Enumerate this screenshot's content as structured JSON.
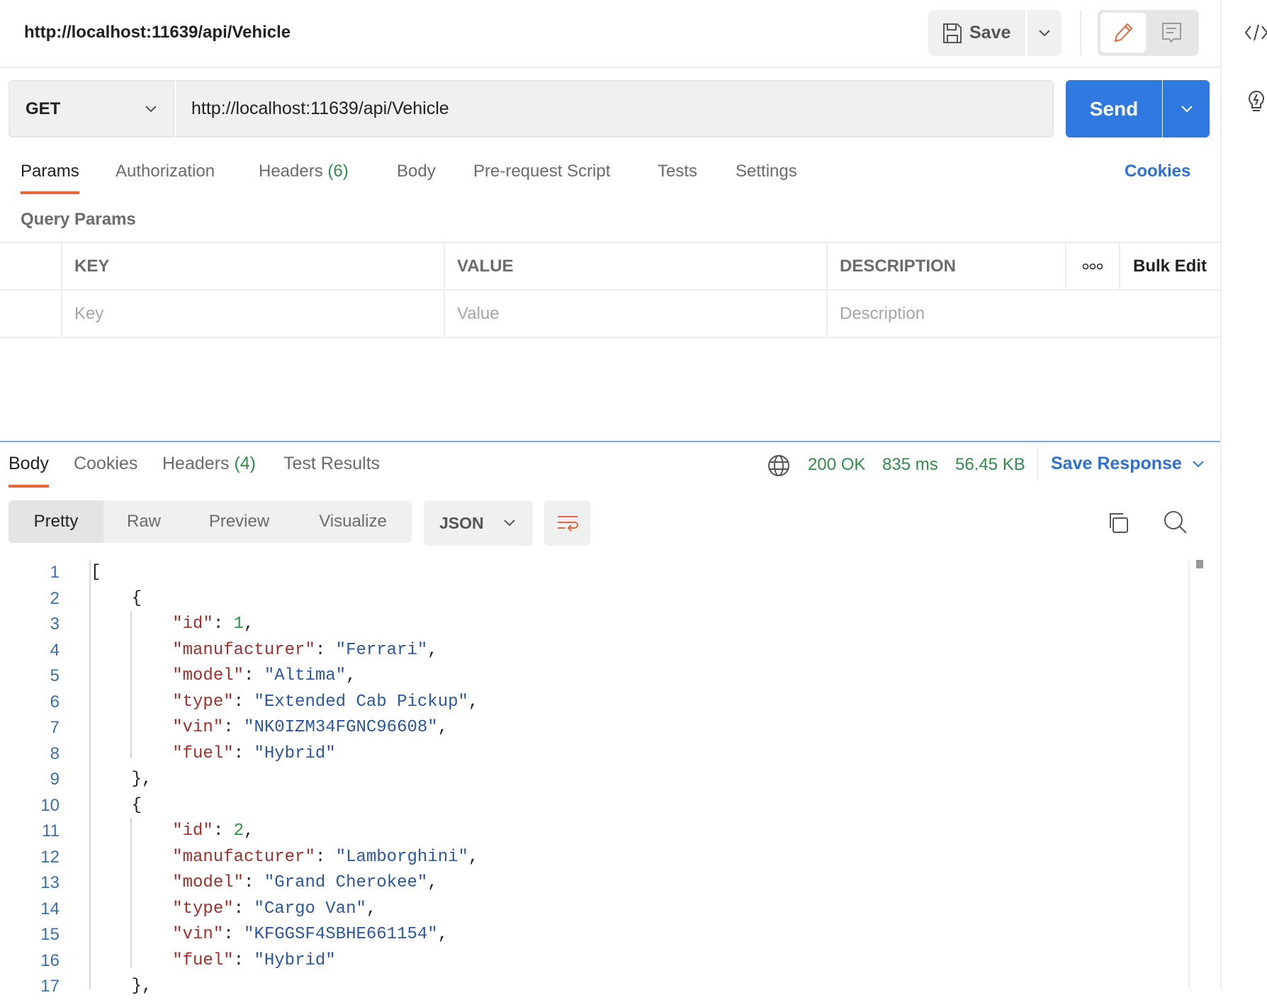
{
  "header": {
    "title": "http://localhost:11639/api/Vehicle",
    "save_label": "Save"
  },
  "request": {
    "method": "GET",
    "url": "http://localhost:11639/api/Vehicle",
    "send_label": "Send"
  },
  "tabs": [
    {
      "label": "Params",
      "active": true
    },
    {
      "label": "Authorization"
    },
    {
      "label": "Headers",
      "count": "(6)"
    },
    {
      "label": "Body"
    },
    {
      "label": "Pre-request Script"
    },
    {
      "label": "Tests"
    },
    {
      "label": "Settings"
    }
  ],
  "cookies_label": "Cookies",
  "query_params": {
    "title": "Query Params",
    "columns": [
      "KEY",
      "VALUE",
      "DESCRIPTION"
    ],
    "bulk_edit": "Bulk Edit",
    "placeholders": {
      "key": "Key",
      "value": "Value",
      "description": "Description"
    }
  },
  "response": {
    "tabs": [
      {
        "label": "Body",
        "active": true
      },
      {
        "label": "Cookies"
      },
      {
        "label": "Headers",
        "count": "(4)"
      },
      {
        "label": "Test Results"
      }
    ],
    "status": "200 OK",
    "time": "835 ms",
    "size": "56.45 KB",
    "save_response": "Save Response",
    "views": [
      "Pretty",
      "Raw",
      "Preview",
      "Visualize"
    ],
    "format": "JSON",
    "lines": [
      [
        [
          "p",
          "["
        ]
      ],
      [
        [
          "p",
          "    {"
        ]
      ],
      [
        [
          "p",
          "        "
        ],
        [
          "k",
          "\"id\""
        ],
        [
          "p",
          ": "
        ],
        [
          "n",
          "1"
        ],
        [
          "p",
          ","
        ]
      ],
      [
        [
          "p",
          "        "
        ],
        [
          "k",
          "\"manufacturer\""
        ],
        [
          "p",
          ": "
        ],
        [
          "s",
          "\"Ferrari\""
        ],
        [
          "p",
          ","
        ]
      ],
      [
        [
          "p",
          "        "
        ],
        [
          "k",
          "\"model\""
        ],
        [
          "p",
          ": "
        ],
        [
          "s",
          "\"Altima\""
        ],
        [
          "p",
          ","
        ]
      ],
      [
        [
          "p",
          "        "
        ],
        [
          "k",
          "\"type\""
        ],
        [
          "p",
          ": "
        ],
        [
          "s",
          "\"Extended Cab Pickup\""
        ],
        [
          "p",
          ","
        ]
      ],
      [
        [
          "p",
          "        "
        ],
        [
          "k",
          "\"vin\""
        ],
        [
          "p",
          ": "
        ],
        [
          "s",
          "\"NK0IZM34FGNC96608\""
        ],
        [
          "p",
          ","
        ]
      ],
      [
        [
          "p",
          "        "
        ],
        [
          "k",
          "\"fuel\""
        ],
        [
          "p",
          ": "
        ],
        [
          "s",
          "\"Hybrid\""
        ]
      ],
      [
        [
          "p",
          "    },"
        ]
      ],
      [
        [
          "p",
          "    {"
        ]
      ],
      [
        [
          "p",
          "        "
        ],
        [
          "k",
          "\"id\""
        ],
        [
          "p",
          ": "
        ],
        [
          "n",
          "2"
        ],
        [
          "p",
          ","
        ]
      ],
      [
        [
          "p",
          "        "
        ],
        [
          "k",
          "\"manufacturer\""
        ],
        [
          "p",
          ": "
        ],
        [
          "s",
          "\"Lamborghini\""
        ],
        [
          "p",
          ","
        ]
      ],
      [
        [
          "p",
          "        "
        ],
        [
          "k",
          "\"model\""
        ],
        [
          "p",
          ": "
        ],
        [
          "s",
          "\"Grand Cherokee\""
        ],
        [
          "p",
          ","
        ]
      ],
      [
        [
          "p",
          "        "
        ],
        [
          "k",
          "\"type\""
        ],
        [
          "p",
          ": "
        ],
        [
          "s",
          "\"Cargo Van\""
        ],
        [
          "p",
          ","
        ]
      ],
      [
        [
          "p",
          "        "
        ],
        [
          "k",
          "\"vin\""
        ],
        [
          "p",
          ": "
        ],
        [
          "s",
          "\"KFGGSF4SBHE661154\""
        ],
        [
          "p",
          ","
        ]
      ],
      [
        [
          "p",
          "        "
        ],
        [
          "k",
          "\"fuel\""
        ],
        [
          "p",
          ": "
        ],
        [
          "s",
          "\"Hybrid\""
        ]
      ],
      [
        [
          "p",
          "    },"
        ]
      ]
    ]
  },
  "colors": {
    "accent": "#e8643b",
    "send": "#3079e0",
    "link": "#2e6fd8",
    "status": "#2f8f46"
  }
}
